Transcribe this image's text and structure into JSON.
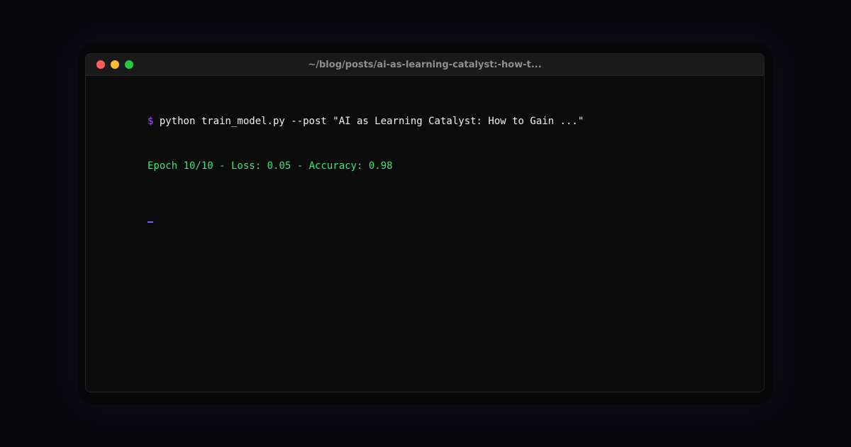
{
  "window": {
    "title": "~/blog/posts/ai-as-learning-catalyst:-how-t..."
  },
  "terminal": {
    "prompt_symbol": "$",
    "command": "python train_model.py --post \"AI as Learning Catalyst: How to Gain ...\"",
    "output": "Epoch 10/10 - Loss: 0.05 - Accuracy: 0.98"
  },
  "colors": {
    "background": "#070709",
    "window_background": "#0b0b0b",
    "titlebar_background": "#1a1a1b",
    "traffic_close": "#ff5f57",
    "traffic_minimize": "#febc2e",
    "traffic_maximize": "#28c840",
    "prompt": "#9b59f5",
    "command_text": "#f1f1f1",
    "output_text": "#3ee27f",
    "cursor": "#7b5cff"
  },
  "icons": {
    "close": "close-dot-icon",
    "minimize": "minimize-dot-icon",
    "maximize": "maximize-dot-icon"
  }
}
